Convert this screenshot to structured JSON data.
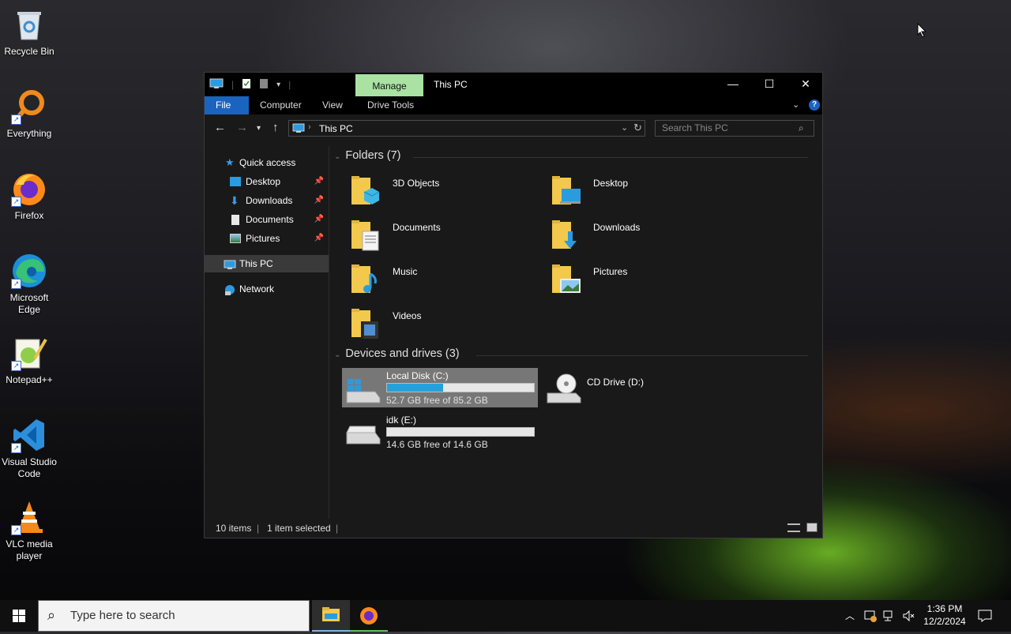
{
  "desktop": {
    "icons": [
      {
        "label": "Recycle Bin",
        "icon": "recycle-bin-icon"
      },
      {
        "label": "Everything",
        "icon": "everything-search-icon"
      },
      {
        "label": "Firefox",
        "icon": "firefox-icon"
      },
      {
        "label": "Microsoft Edge",
        "icon": "edge-icon"
      },
      {
        "label": "Notepad++",
        "icon": "notepad-plus-plus-icon"
      },
      {
        "label": "Visual Studio Code",
        "icon": "vscode-icon"
      },
      {
        "label": "VLC media player",
        "icon": "vlc-icon"
      }
    ]
  },
  "window": {
    "title": "This PC",
    "contextual_tab": "Manage",
    "ribbon_tabs": [
      "File",
      "Computer",
      "View",
      "Drive Tools"
    ],
    "controls": {
      "minimize": "—",
      "maximize": "☐",
      "close": "✕"
    },
    "address": {
      "path": "This PC"
    },
    "search": {
      "placeholder": "Search This PC"
    },
    "nav": {
      "quick_access": "Quick access",
      "quick_items": [
        "Desktop",
        "Downloads",
        "Documents",
        "Pictures"
      ],
      "this_pc": "This PC",
      "network": "Network"
    },
    "folders_header": "Folders (7)",
    "folders": [
      "3D Objects",
      "Desktop",
      "Documents",
      "Downloads",
      "Music",
      "Pictures",
      "Videos"
    ],
    "drives_header": "Devices and drives (3)",
    "drives": [
      {
        "name": "Local Disk (C:)",
        "free": "52.7 GB free of 85.2 GB",
        "used_fraction": 0.38,
        "selected": true
      },
      {
        "name": "CD Drive (D:)"
      },
      {
        "name": "idk (E:)",
        "free": "14.6 GB free of 14.6 GB",
        "used_fraction": 0.0,
        "selected": false
      }
    ],
    "status": {
      "items": "10 items",
      "selected": "1 item selected"
    }
  },
  "taskbar": {
    "search_placeholder": "Type here to search",
    "time": "1:36 PM",
    "date": "12/2/2024"
  },
  "colors": {
    "accent": "#1a64c0",
    "manage_tab": "#a9e2a3",
    "drive_fill": "#26a0da"
  }
}
